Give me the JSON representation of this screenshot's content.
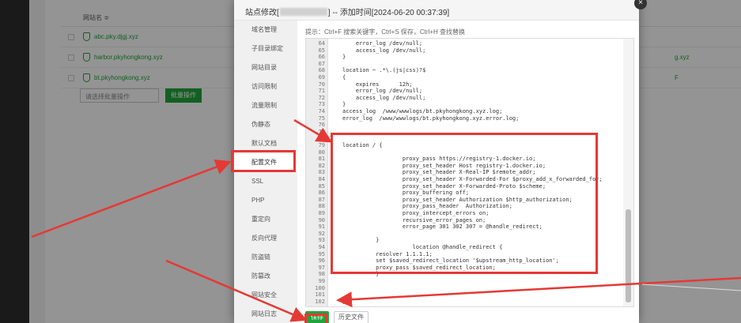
{
  "background": {
    "header_col": "网站名 ≑",
    "rows": [
      {
        "name": "abc.pky.djgj.xyz",
        "right": ""
      },
      {
        "name": "harbor.pkyhongkong.xyz",
        "right": "g.xyz"
      },
      {
        "name": "bt.pkyhongkong.xyz",
        "right": "F"
      }
    ],
    "select_placeholder": "请选择批量操作",
    "batch_button": "批量操作"
  },
  "modal": {
    "title_prefix": "站点修改[",
    "title_suffix": "] -- 添加时间[2024-06-20 00:37:39]",
    "close_symbol": "×",
    "tip": "提示：Ctrl+F 搜索关键字，Ctrl+S 保存，Ctrl+H 查找替换",
    "save_button": "保存",
    "history_button": "历史文件",
    "menu": [
      {
        "label": "域名管理",
        "active": false
      },
      {
        "label": "子目录绑定",
        "active": false
      },
      {
        "label": "网站目录",
        "active": false
      },
      {
        "label": "访问限制",
        "active": false
      },
      {
        "label": "流量限制",
        "active": false
      },
      {
        "label": "伪静态",
        "active": false
      },
      {
        "label": "默认文档",
        "active": false
      },
      {
        "label": "配置文件",
        "active": true
      },
      {
        "label": "SSL",
        "active": false
      },
      {
        "label": "PHP",
        "active": false
      },
      {
        "label": "重定向",
        "active": false
      },
      {
        "label": "反向代理",
        "active": false
      },
      {
        "label": "防盗链",
        "active": false
      },
      {
        "label": "防篡改",
        "active": false
      },
      {
        "label": "网站安全",
        "active": false
      },
      {
        "label": "网站日志",
        "active": false
      }
    ]
  },
  "code_lines": [
    {
      "n": "64",
      "t": "    error_log /dev/null;"
    },
    {
      "n": "65",
      "t": "    access_log /dev/null;"
    },
    {
      "n": "66",
      "t": "}"
    },
    {
      "n": "67",
      "t": ""
    },
    {
      "n": "68",
      "t": "location ~ .*\\.(js|css)?$"
    },
    {
      "n": "69",
      "t": "{"
    },
    {
      "n": "70",
      "t": "    expires      12h;"
    },
    {
      "n": "71",
      "t": "    error_log /dev/null;"
    },
    {
      "n": "72",
      "t": "    access_log /dev/null;"
    },
    {
      "n": "73",
      "t": "}"
    },
    {
      "n": "74",
      "t": "access_log  /www/wwwlogs/bt.pkyhongkong.xyz.log;"
    },
    {
      "n": "75",
      "t": "error_log  /www/wwwlogs/bt.pkyhongkong.xyz.error.log;"
    },
    {
      "n": "76",
      "t": ""
    },
    {
      "n": "77",
      "t": ""
    },
    {
      "n": "78",
      "t": ""
    },
    {
      "n": "79",
      "t": "location / {"
    },
    {
      "n": "80",
      "t": ""
    },
    {
      "n": "81",
      "t": "                  proxy_pass https://registry-1.docker.io;"
    },
    {
      "n": "82",
      "t": "                  proxy_set_header Host registry-1.docker.io;"
    },
    {
      "n": "83",
      "t": "                  proxy_set_header X-Real-IP $remote_addr;"
    },
    {
      "n": "84",
      "t": "                  proxy_set_header X-Forwarded-For $proxy_add_x_forwarded_for;"
    },
    {
      "n": "85",
      "t": "                  proxy_set_header X-Forwarded-Proto $scheme;"
    },
    {
      "n": "86",
      "t": "                  proxy_buffering off;"
    },
    {
      "n": "87",
      "t": "                  proxy_set_header Authorization $http_authorization;"
    },
    {
      "n": "88",
      "t": "                  proxy_pass_header  Authorization;"
    },
    {
      "n": "89",
      "t": "                  proxy_intercept_errors on;"
    },
    {
      "n": "90",
      "t": "                  recursive_error_pages on;"
    },
    {
      "n": "91",
      "t": "                  error_page 301 302 307 = @handle_redirect;"
    },
    {
      "n": "92",
      "t": ""
    },
    {
      "n": "93",
      "t": "          }"
    },
    {
      "n": "94",
      "t": "                     location @handle_redirect {"
    },
    {
      "n": "95",
      "t": "          resolver 1.1.1.1;"
    },
    {
      "n": "96",
      "t": "          set $saved_redirect_location '$upstream_http_location';"
    },
    {
      "n": "97",
      "t": "          proxy_pass $saved_redirect_location;"
    },
    {
      "n": "98",
      "t": "          }"
    },
    {
      "n": "99",
      "t": ""
    },
    {
      "n": "100",
      "t": ""
    },
    {
      "n": "101",
      "t": ""
    },
    {
      "n": "102",
      "t": "}"
    }
  ],
  "colors": {
    "accent_green": "#20a53a",
    "annotation_red": "#e53935"
  }
}
